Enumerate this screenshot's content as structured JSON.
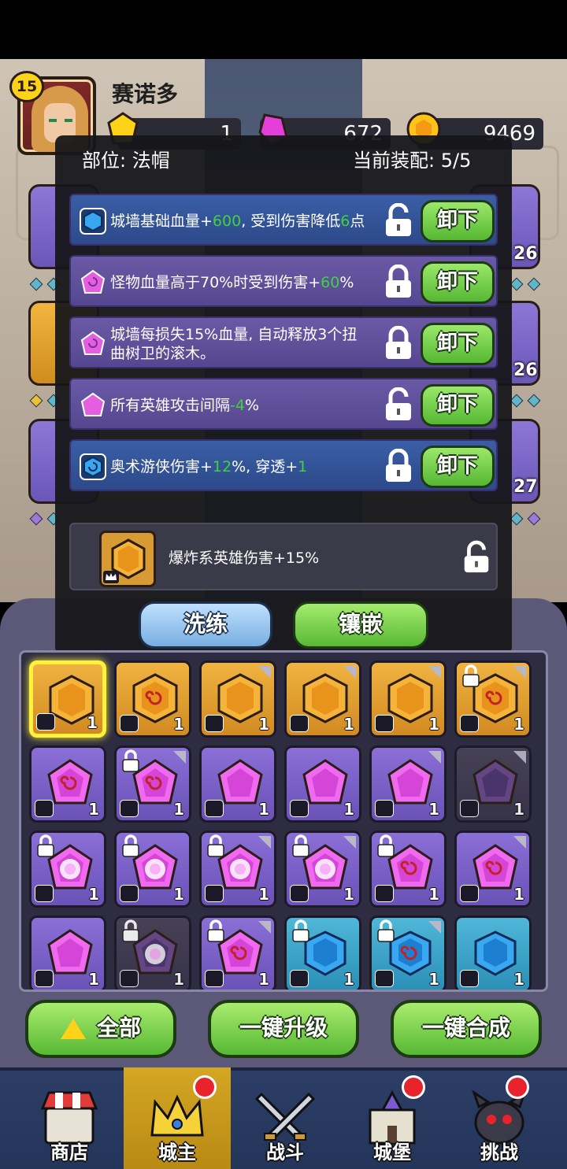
{
  "player": {
    "level": "15",
    "name": "赛诺多",
    "resources": {
      "gold_gem": "1",
      "pink_gem": "672",
      "coin": "9469"
    }
  },
  "side_cards": {
    "levels": [
      "26",
      "26",
      "27"
    ]
  },
  "panel": {
    "slot_label": "部位: 法帽",
    "equip_label": "当前装配: 5/5",
    "affixes": [
      {
        "parts": [
          "城墙基础血量+",
          "600",
          ", 受到伤害降低",
          "6",
          "点"
        ],
        "gem": "blue",
        "locked": false
      },
      {
        "parts": [
          "怪物血量高于70%时受到伤害+",
          "60",
          "%",
          "",
          ""
        ],
        "gem": "purple-swirl",
        "locked": true
      },
      {
        "parts": [
          "城墙每损失15%血量, 自动释放3个扭曲树卫的滚木。",
          "",
          "",
          "",
          ""
        ],
        "gem": "purple-swirl",
        "locked": true
      },
      {
        "parts": [
          "所有英雄攻击间隔",
          "-4",
          "%",
          "",
          ""
        ],
        "gem": "purple",
        "locked": false
      },
      {
        "parts": [
          "奥术游侠伤害+",
          "12",
          "%, 穿透+",
          "1",
          ""
        ],
        "gem": "blue-swirl",
        "locked": true
      }
    ],
    "unload_label": "卸下",
    "special": {
      "text": "爆炸系英雄伤害+15%",
      "locked": false
    },
    "refine_label": "洗练",
    "inlay_label": "镶嵌"
  },
  "inventory": {
    "rows": [
      [
        {
          "color": "gold",
          "gem": "plain",
          "type": "crown",
          "count": "1",
          "selected": true
        },
        {
          "color": "gold",
          "gem": "swirl",
          "type": "boot",
          "count": "1"
        },
        {
          "color": "gold",
          "gem": "plain",
          "type": "staff",
          "count": "1",
          "corner": true
        },
        {
          "color": "gold",
          "gem": "plain",
          "type": "ring",
          "count": "1",
          "corner": true
        },
        {
          "color": "gold",
          "gem": "plain",
          "type": "bow",
          "count": "1",
          "corner": true
        },
        {
          "color": "gold",
          "gem": "swirl",
          "type": "bow",
          "count": "1",
          "locked": true,
          "corner": true
        }
      ],
      [
        {
          "color": "purple",
          "gem": "swirl",
          "type": "crown",
          "count": "1"
        },
        {
          "color": "purple",
          "gem": "swirl",
          "type": "armor",
          "count": "1",
          "locked": true,
          "corner": true
        },
        {
          "color": "purple",
          "gem": "plain",
          "type": "staff",
          "count": "1"
        },
        {
          "color": "purple",
          "gem": "plain",
          "type": "staff",
          "count": "1"
        },
        {
          "color": "purple",
          "gem": "plain",
          "type": "staff",
          "count": "1",
          "corner": true
        },
        {
          "color": "dark",
          "gem": "plain",
          "type": "staff",
          "count": "1",
          "corner": true
        }
      ],
      [
        {
          "color": "purple",
          "gem": "burst",
          "type": "staff",
          "count": "1",
          "locked": true
        },
        {
          "color": "purple",
          "gem": "burst",
          "type": "staff",
          "count": "1",
          "locked": true
        },
        {
          "color": "purple",
          "gem": "burst",
          "type": "staff",
          "count": "1",
          "locked": true,
          "corner": true
        },
        {
          "color": "purple",
          "gem": "burst",
          "type": "staff",
          "count": "1",
          "locked": true,
          "corner": true
        },
        {
          "color": "purple",
          "gem": "swirl",
          "type": "staff",
          "count": "1",
          "locked": true
        },
        {
          "color": "purple",
          "gem": "swirl",
          "type": "ring",
          "count": "1",
          "corner": true
        }
      ],
      [
        {
          "color": "purple",
          "gem": "plain",
          "type": "ring",
          "count": "1"
        },
        {
          "color": "dark",
          "gem": "burst",
          "type": "ring",
          "count": "1",
          "locked": true
        },
        {
          "color": "purple",
          "gem": "swirl",
          "type": "ring",
          "count": "1",
          "locked": true,
          "corner": true
        },
        {
          "color": "blue",
          "gem": "plain",
          "type": "crown",
          "count": "1",
          "locked": true
        },
        {
          "color": "blue",
          "gem": "swirl",
          "type": "crown",
          "count": "1",
          "locked": true,
          "corner": true
        },
        {
          "color": "blue",
          "gem": "plain",
          "type": "crown",
          "count": "1"
        }
      ]
    ]
  },
  "actions": {
    "all_label": "全部",
    "upgrade_all_label": "一键升级",
    "merge_all_label": "一键合成"
  },
  "nav": {
    "items": [
      {
        "label": "商店",
        "icon": "shop-icon",
        "badge": false
      },
      {
        "label": "城主",
        "icon": "crown-icon",
        "badge": true,
        "active": true
      },
      {
        "label": "战斗",
        "icon": "swords-icon",
        "badge": false
      },
      {
        "label": "城堡",
        "icon": "castle-icon",
        "badge": true
      },
      {
        "label": "挑战",
        "icon": "monster-icon",
        "badge": true
      }
    ]
  },
  "colors": {
    "gold_cell": "#f0b341",
    "purple_cell": "#8a6fd6",
    "blue_cell": "#4fb7d8",
    "green_button": "#56b833",
    "highlight_value": "#3fd23f",
    "nav_active": "#d4a623"
  }
}
